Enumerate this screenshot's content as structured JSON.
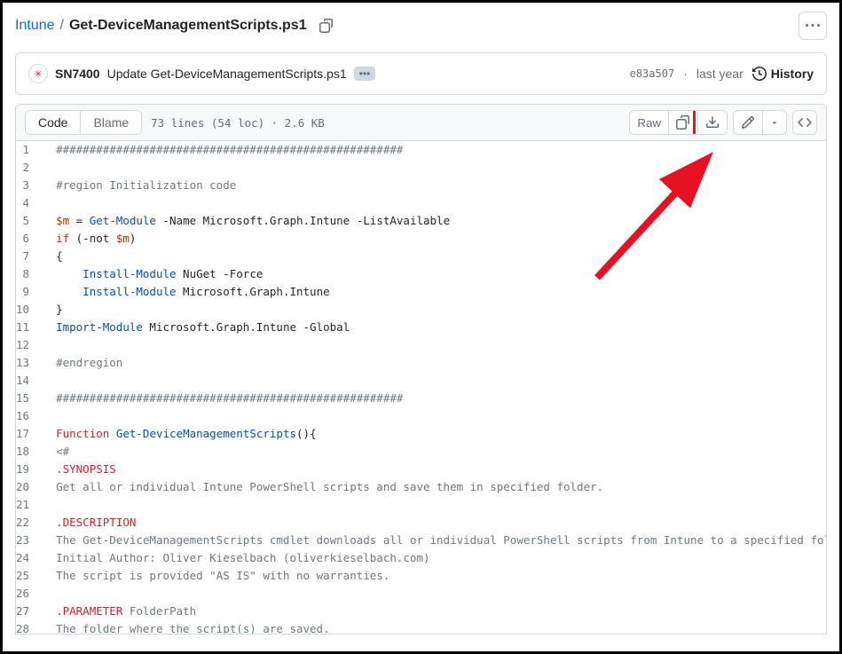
{
  "breadcrumb": {
    "parent": "Intune",
    "file": "Get-DeviceManagementScripts.ps1"
  },
  "commit": {
    "author": "SN7400",
    "message": "Update Get-DeviceManagementScripts.ps1",
    "hash": "e83a507",
    "time": "last year",
    "history_label": "History"
  },
  "toolbar": {
    "code_label": "Code",
    "blame_label": "Blame",
    "meta": "73 lines (54 loc) · 2.6 KB",
    "raw_label": "Raw"
  },
  "code_lines": [
    {
      "n": 1,
      "tokens": [
        {
          "t": "####################################################",
          "c": "tk-c"
        }
      ]
    },
    {
      "n": 2,
      "tokens": []
    },
    {
      "n": 3,
      "tokens": [
        {
          "t": "#region Initialization code",
          "c": "tk-c"
        }
      ]
    },
    {
      "n": 4,
      "tokens": []
    },
    {
      "n": 5,
      "tokens": [
        {
          "t": "$m",
          "c": "tk-v"
        },
        {
          "t": " = "
        },
        {
          "t": "Get-Module",
          "c": "tk-fn"
        },
        {
          "t": " -Name Microsoft.Graph.Intune -ListAvailable"
        }
      ]
    },
    {
      "n": 6,
      "tokens": [
        {
          "t": "if",
          "c": "tk-k"
        },
        {
          "t": " (-not "
        },
        {
          "t": "$m",
          "c": "tk-v"
        },
        {
          "t": ")"
        }
      ]
    },
    {
      "n": 7,
      "tokens": [
        {
          "t": "{"
        }
      ]
    },
    {
      "n": 8,
      "tokens": [
        {
          "t": "    "
        },
        {
          "t": "Install-Module",
          "c": "tk-fn"
        },
        {
          "t": " NuGet -Force"
        }
      ]
    },
    {
      "n": 9,
      "tokens": [
        {
          "t": "    "
        },
        {
          "t": "Install-Module",
          "c": "tk-fn"
        },
        {
          "t": " Microsoft.Graph.Intune"
        }
      ]
    },
    {
      "n": 10,
      "tokens": [
        {
          "t": "}"
        }
      ]
    },
    {
      "n": 11,
      "tokens": [
        {
          "t": "Import-Module",
          "c": "tk-fn"
        },
        {
          "t": " Microsoft.Graph.Intune -Global"
        }
      ]
    },
    {
      "n": 12,
      "tokens": []
    },
    {
      "n": 13,
      "tokens": [
        {
          "t": "#endregion",
          "c": "tk-c"
        }
      ]
    },
    {
      "n": 14,
      "tokens": []
    },
    {
      "n": 15,
      "tokens": [
        {
          "t": "####################################################",
          "c": "tk-c"
        }
      ]
    },
    {
      "n": 16,
      "tokens": []
    },
    {
      "n": 17,
      "tokens": [
        {
          "t": "Function",
          "c": "tk-k"
        },
        {
          "t": " "
        },
        {
          "t": "Get-DeviceManagementScripts",
          "c": "tk-fn"
        },
        {
          "t": "(){"
        }
      ]
    },
    {
      "n": 18,
      "tokens": [
        {
          "t": "<#",
          "c": "tk-c"
        }
      ]
    },
    {
      "n": 19,
      "tokens": [
        {
          "t": ".SYNOPSIS",
          "c": "tk-doc"
        }
      ]
    },
    {
      "n": 20,
      "tokens": [
        {
          "t": "Get all or individual Intune PowerShell scripts and save them in specified folder.",
          "c": "tk-c"
        }
      ]
    },
    {
      "n": 21,
      "tokens": []
    },
    {
      "n": 22,
      "tokens": [
        {
          "t": ".DESCRIPTION",
          "c": "tk-doc"
        }
      ]
    },
    {
      "n": 23,
      "tokens": [
        {
          "t": "The Get-DeviceManagementScripts cmdlet downloads all or individual PowerShell scripts from Intune to a specified folder.",
          "c": "tk-c"
        }
      ]
    },
    {
      "n": 24,
      "tokens": [
        {
          "t": "Initial Author: Oliver Kieselbach (oliverkieselbach.com)",
          "c": "tk-c"
        }
      ]
    },
    {
      "n": 25,
      "tokens": [
        {
          "t": "The script is provided \"AS IS\" with no warranties.",
          "c": "tk-c"
        }
      ]
    },
    {
      "n": 26,
      "tokens": []
    },
    {
      "n": 27,
      "tokens": [
        {
          "t": ".PARAMETER",
          "c": "tk-doc"
        },
        {
          "t": " FolderPath",
          "c": "tk-c"
        }
      ]
    },
    {
      "n": 28,
      "tokens": [
        {
          "t": "The folder where the script(s) are saved.",
          "c": "tk-c"
        }
      ]
    }
  ]
}
